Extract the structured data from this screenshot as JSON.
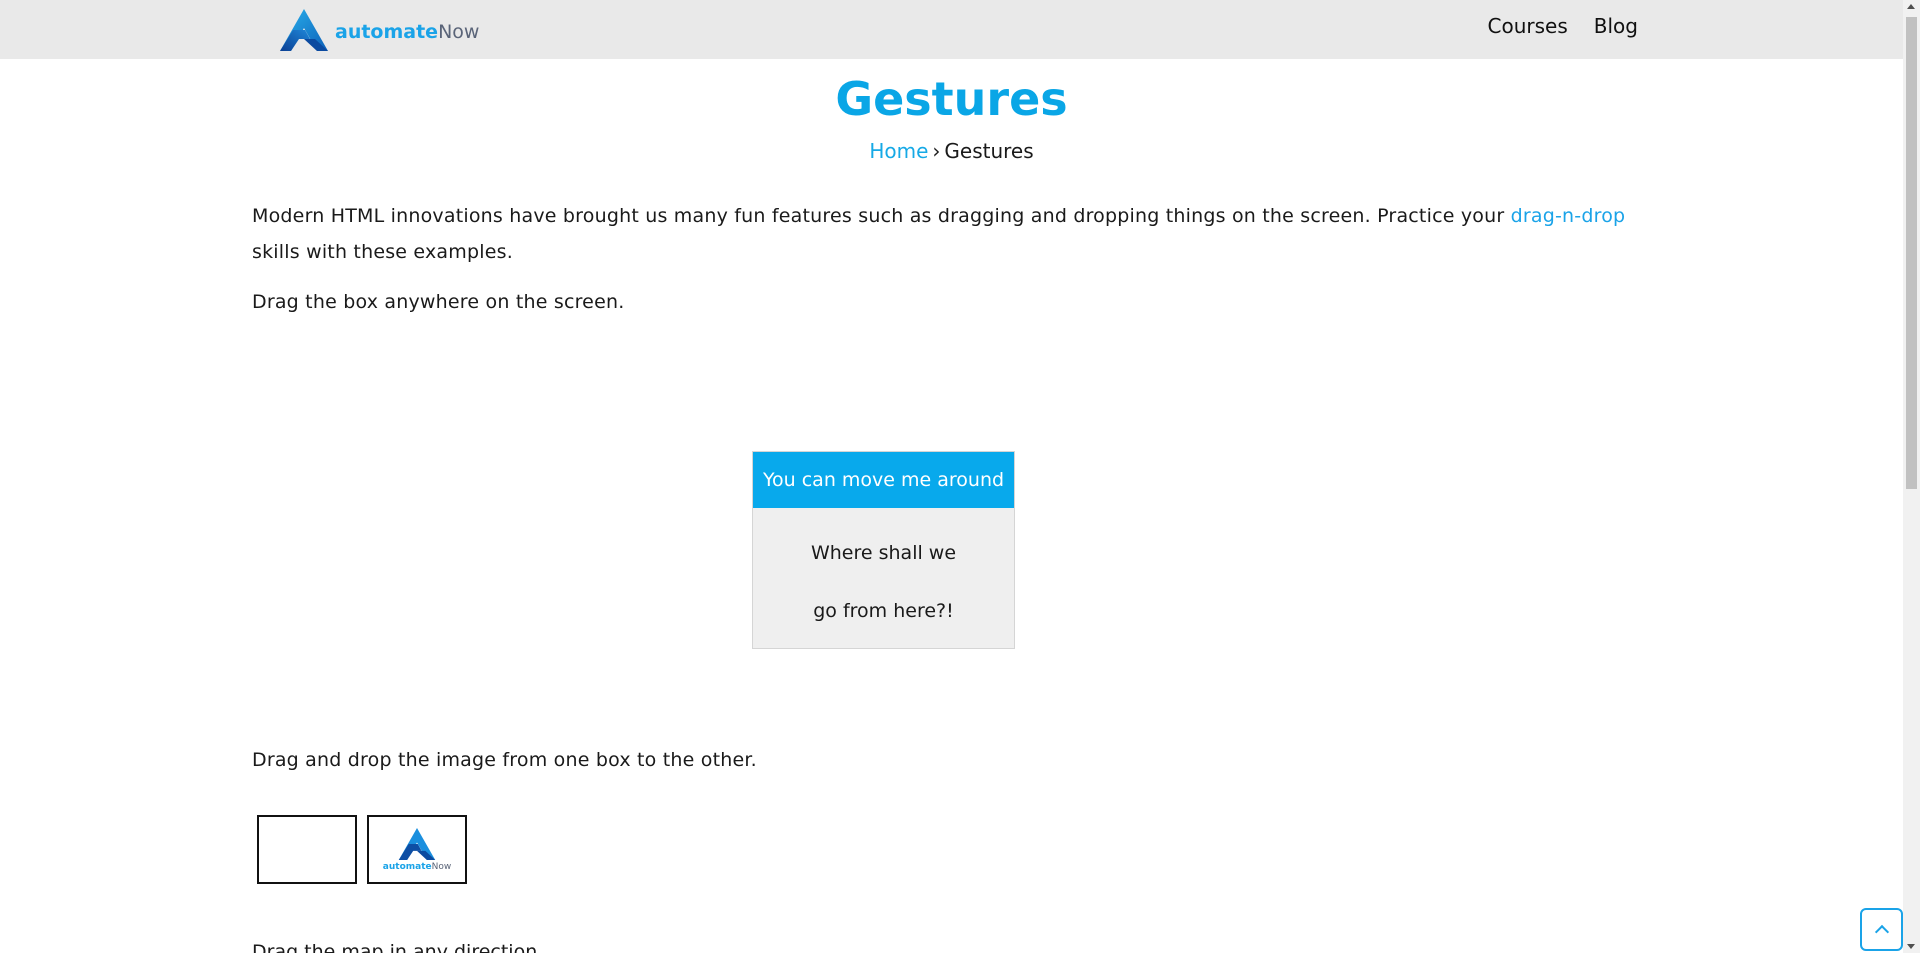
{
  "header": {
    "logo_text_bold": "automate",
    "logo_text_regular": "Now",
    "nav": [
      {
        "label": "Courses"
      },
      {
        "label": "Blog"
      }
    ]
  },
  "page": {
    "title": "Gestures",
    "breadcrumb": {
      "home": "Home",
      "separator": "›",
      "current": "Gestures"
    }
  },
  "intro": {
    "text_before": "Modern HTML innovations have brought us many fun features such as dragging and dropping things on the screen. Practice your ",
    "link": "drag-n-drop",
    "text_after": " skills with these examples."
  },
  "drag_section": {
    "instruction": "Drag the box anywhere on the screen.",
    "box_header": "You can move me around",
    "box_line1": "Where shall we",
    "box_line2": "go from here?!"
  },
  "image_section": {
    "instruction": "Drag and drop the image from one box to the other.",
    "image_text_bold": "automate",
    "image_text_regular": "Now"
  },
  "cut_section": {
    "instruction": "Drag the map in any direction."
  },
  "colors": {
    "accent": "#08a9ec",
    "header_bg": "#e9e9e9"
  },
  "icons": {
    "logo": "automatenow-logo-icon",
    "back_to_top": "chevron-up-icon"
  }
}
